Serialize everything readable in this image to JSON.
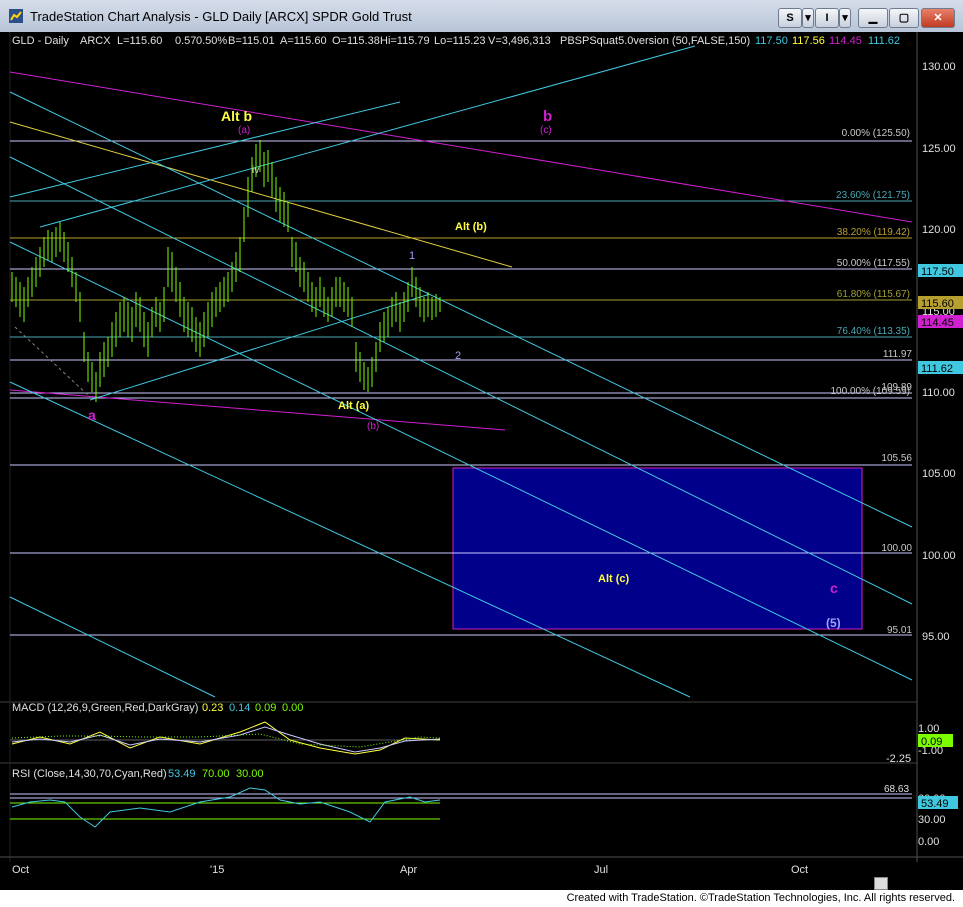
{
  "window": {
    "title": "TradeStation Chart Analysis - GLD Daily [ARCX] SPDR Gold Trust",
    "buttons": {
      "s": "S",
      "i": "I"
    }
  },
  "header": {
    "symbol": "GLD - Daily",
    "exchange": "ARCX",
    "last": "L=115.60",
    "change": "0.57",
    "change_pct": "0.50%",
    "bid": "B=115.01",
    "ask": "A=115.60",
    "open": "O=115.38",
    "high": "Hi=115.79",
    "low": "Lo=115.23",
    "volume": "V=3,496,313",
    "indicator_name": "PBSPSquat5.0version (50,FALSE,150)",
    "ind_v1": "117.50",
    "ind_v2": "117.56",
    "ind_v3": "114.45",
    "ind_v4": "111.62"
  },
  "price_axis": {
    "ticks": [
      "130.00",
      "125.00",
      "120.00",
      "115.00",
      "110.00",
      "105.00",
      "100.00",
      "95.00"
    ],
    "badges": {
      "b1": "117.50",
      "b2": "115.60",
      "b3": "114.45",
      "b4": "111.62"
    }
  },
  "fib_levels": {
    "f0": "0.00% (125.50)",
    "f236": "23.60% (121.75)",
    "f382": "38.20% (119.42)",
    "f50": "50.00% (117.55)",
    "f618": "61.80% (115.67)",
    "f764": "76.40% (113.35)",
    "f100": "100.00% (109.59)",
    "l111": "111.97",
    "l109": "109.89",
    "l105": "105.56",
    "l100": "100.00",
    "l95": "95.01"
  },
  "annotations": {
    "alt_b": "Alt b",
    "alt_b_sub": "(a)",
    "b": "b",
    "b_sub": "(c)",
    "alt_pb": "Alt (b)",
    "one": "1",
    "two": "2",
    "a": "a",
    "alt_a": "Alt (a)",
    "pb": "(b)",
    "iv": "iv",
    "alt_c": "Alt (c)",
    "c": "c",
    "five": "(5)"
  },
  "macd": {
    "label": "MACD (12,26,9,Green,Red,DarkGray)",
    "v1": "0.23",
    "v2": "0.14",
    "v3": "0.09",
    "v4": "0.00",
    "ticks": [
      "1.00",
      "-1.00"
    ],
    "extra": "-2.25",
    "badge": "0.09"
  },
  "rsi": {
    "label": "RSI (Close,14,30,70,Cyan,Red)",
    "v1": "53.49",
    "v2": "70.00",
    "v3": "30.00",
    "ticks": [
      "60.00",
      "30.00",
      "0.00"
    ],
    "marker": "68.63",
    "badge": "53.49"
  },
  "time_axis": {
    "labels": [
      "Oct",
      "'15",
      "Apr",
      "Jul",
      "Oct"
    ]
  },
  "footer": "Created with TradeStation. ©TradeStation Technologies, Inc. All rights reserved.",
  "colors": {
    "background": "#000000",
    "accent_blue": "#00008b",
    "bars": "#7cfc00",
    "magenta": "#d020d0",
    "yellow": "#ffff40",
    "cyan": "#40c8e0",
    "fib_line": "#c8c8ff"
  }
}
